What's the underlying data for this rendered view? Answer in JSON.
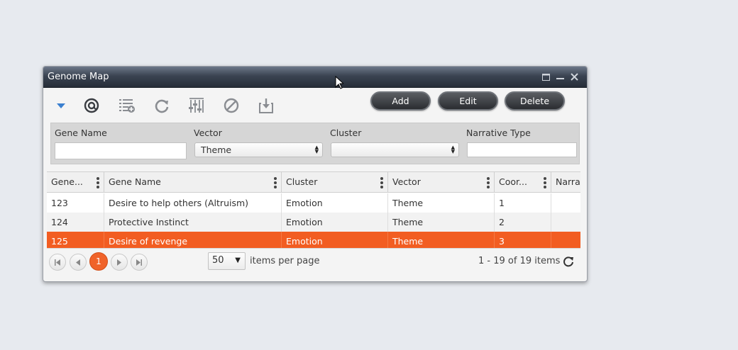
{
  "window": {
    "title": "Genome Map",
    "controls": [
      "maximize-icon",
      "minimize-icon",
      "close-icon"
    ]
  },
  "toolbar": {
    "icons": [
      "filter-dropdown-icon",
      "search-at-icon",
      "add-to-list-icon",
      "refresh-icon",
      "column-settings-icon",
      "block-icon",
      "export-icon"
    ],
    "accent_color": "#3a7fcf",
    "add_label": "Add",
    "edit_label": "Edit",
    "delete_label": "Delete"
  },
  "filters": {
    "gene_name_label": "Gene Name",
    "gene_name_value": "",
    "vector_label": "Vector",
    "vector_value": "Theme",
    "cluster_label": "Cluster",
    "cluster_value": "",
    "narrative_type_label": "Narrative Type",
    "narrative_type_value": ""
  },
  "grid": {
    "columns": [
      "Gene...",
      "Gene Name",
      "Cluster",
      "Vector",
      "Coor...",
      "Narra"
    ],
    "rows": [
      [
        "123",
        "Desire to help others (Altruism)",
        "Emotion",
        "Theme",
        "1",
        ""
      ],
      [
        "124",
        "Protective Instinct",
        "Emotion",
        "Theme",
        "2",
        ""
      ],
      [
        "125",
        "Desire of revenge",
        "Emotion",
        "Theme",
        "3",
        ""
      ]
    ],
    "selected_row": 2,
    "selected_color": "#f25d22"
  },
  "pager": {
    "current_page": "1",
    "page_size": "50",
    "items_per_page_label": "items per page",
    "summary": "1 - 19 of 19 items"
  }
}
